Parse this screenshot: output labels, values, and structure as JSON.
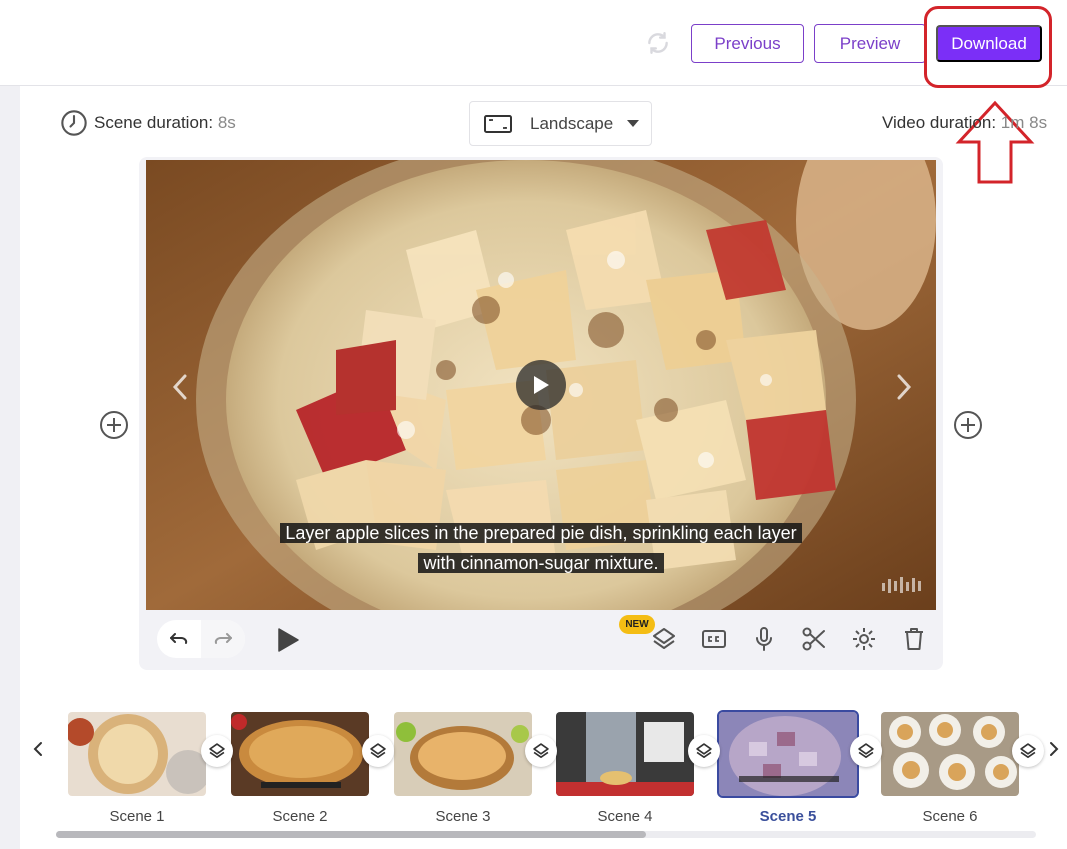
{
  "toolbar": {
    "previous_label": "Previous",
    "preview_label": "Preview",
    "download_label": "Download"
  },
  "scene_info": {
    "scene_duration_label": "Scene duration:",
    "scene_duration_value": "8s",
    "orientation": "Landscape",
    "video_duration_label": "Video duration:",
    "video_duration_value": "1m 8s"
  },
  "player": {
    "caption_line1": "Layer apple slices in the prepared pie dish, sprinkling each layer",
    "caption_line2": "with cinnamon-sugar mixture."
  },
  "controls": {
    "new_badge": "NEW"
  },
  "scenes": [
    {
      "label": "Scene 1",
      "active": false
    },
    {
      "label": "Scene 2",
      "active": false
    },
    {
      "label": "Scene 3",
      "active": false
    },
    {
      "label": "Scene 4",
      "active": false
    },
    {
      "label": "Scene 5",
      "active": true
    },
    {
      "label": "Scene 6",
      "active": false
    }
  ],
  "colors": {
    "accent": "#7b2ff7",
    "annotation": "#d3242a",
    "active_scene": "#3a4f9b",
    "badge": "#f4bd14"
  }
}
